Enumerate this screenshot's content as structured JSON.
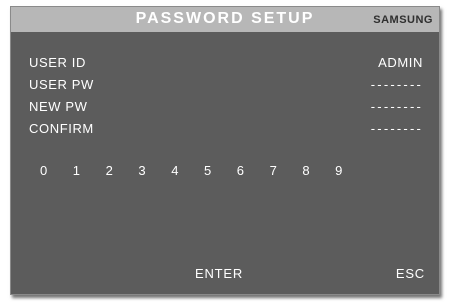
{
  "header": {
    "title": "PASSWORD SETUP",
    "brand": "SAMSUNG"
  },
  "fields": [
    {
      "label": "USER ID",
      "value": "ADMIN"
    },
    {
      "label": "USER PW",
      "value": "--------"
    },
    {
      "label": "NEW PW",
      "value": "--------"
    },
    {
      "label": "CONFIRM",
      "value": "--------"
    }
  ],
  "keypad": [
    "0",
    "1",
    "2",
    "3",
    "4",
    "5",
    "6",
    "7",
    "8",
    "9"
  ],
  "actions": {
    "enter": "ENTER",
    "esc": "ESC"
  }
}
